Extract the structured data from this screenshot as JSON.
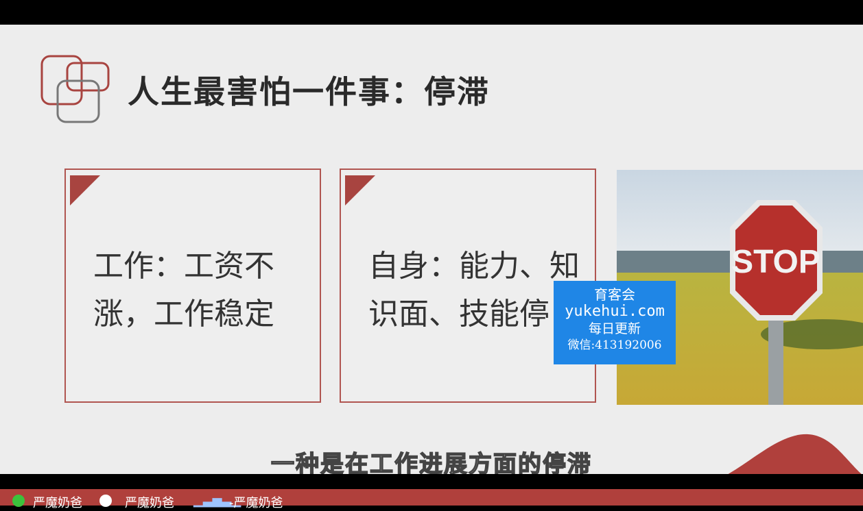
{
  "slide": {
    "title": "人生最害怕一件事：停滞",
    "cards": [
      {
        "text": "工作：工资不涨，工作稳定"
      },
      {
        "text": "自身：能力、知识面、技能停"
      }
    ],
    "photo_sign": "STOP",
    "subtitle": "一种是在工作进展方面的停滞"
  },
  "watermark": {
    "line1": "育客会",
    "line2": "yukehui.com",
    "line3": "每日更新",
    "line4": "微信:413192006"
  },
  "footer": {
    "items": [
      "严魔奶爸",
      "严魔奶爸",
      "-严魔奶爸"
    ]
  },
  "colors": {
    "accent": "#b0403c",
    "card_border": "#b05550",
    "watermark_bg": "#1f86e6"
  }
}
